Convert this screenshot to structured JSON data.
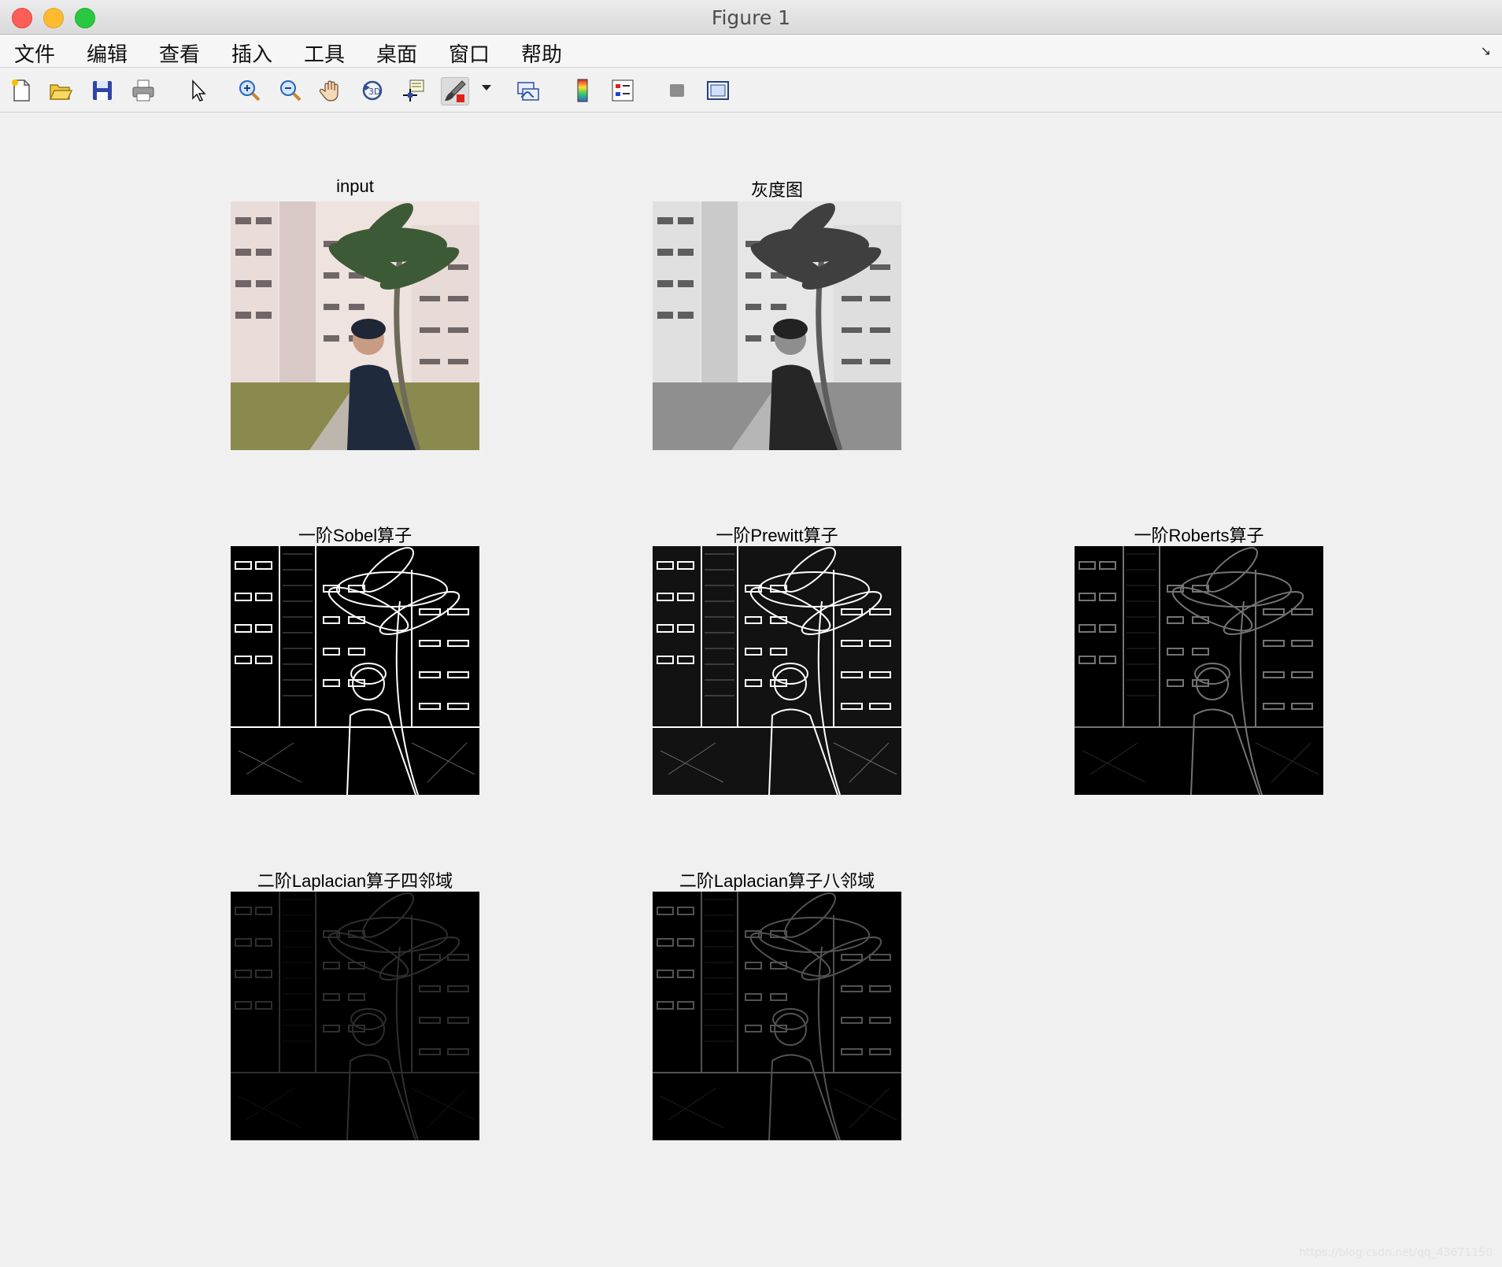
{
  "window": {
    "title": "Figure 1"
  },
  "menu": [
    "文件",
    "编辑",
    "查看",
    "插入",
    "工具",
    "桌面",
    "窗口",
    "帮助"
  ],
  "toolbar": {
    "buttons": [
      "new-figure",
      "open-file",
      "save",
      "print",
      "edit-plot-arrow",
      "zoom-in",
      "zoom-out",
      "pan-hand",
      "rotate-3d",
      "data-cursor",
      "brush",
      "link-plot",
      "insert-colorbar",
      "insert-legend",
      "hide-plot-tools",
      "show-plot-tools"
    ]
  },
  "subplots": [
    {
      "title": "input"
    },
    {
      "title": "灰度图"
    },
    {
      "title": "一阶Sobel算子"
    },
    {
      "title": "一阶Prewitt算子"
    },
    {
      "title": "一阶Roberts算子"
    },
    {
      "title": "二阶Laplacian算子四邻域"
    },
    {
      "title": "二阶Laplacian算子八邻域"
    }
  ],
  "watermark": "https://blog.csdn.net/qq_43671150"
}
